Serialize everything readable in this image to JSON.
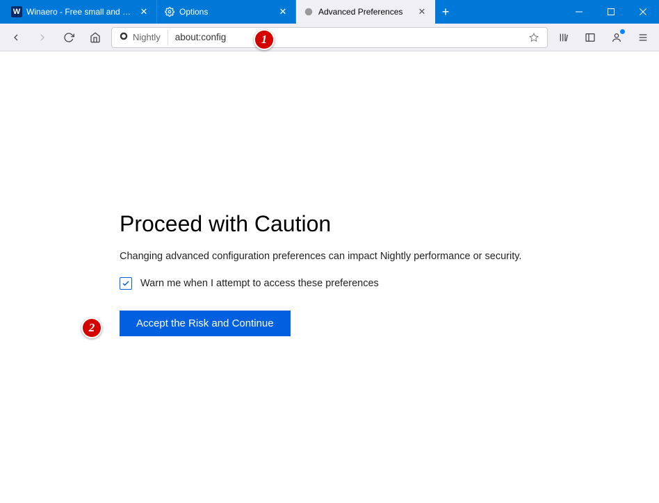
{
  "tabs": [
    {
      "title": "Winaero - Free small and usef..."
    },
    {
      "title": "Options"
    },
    {
      "title": "Advanced Preferences"
    }
  ],
  "url": {
    "identity_label": "Nightly",
    "value": "about:config"
  },
  "page": {
    "heading": "Proceed with Caution",
    "paragraph": "Changing advanced configuration preferences can impact Nightly performance or security.",
    "checkbox_label": "Warn me when I attempt to access these preferences",
    "accept_label": "Accept the Risk and Continue"
  },
  "annotations": {
    "badge1": "1",
    "badge2": "2"
  }
}
